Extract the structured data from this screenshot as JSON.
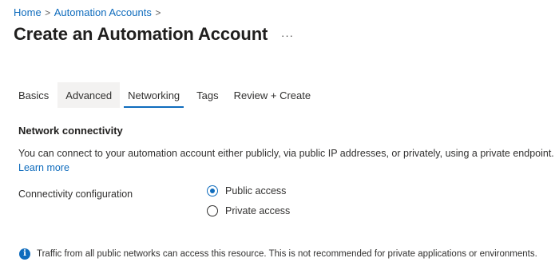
{
  "breadcrumb": {
    "items": [
      "Home",
      "Automation Accounts"
    ],
    "separator": ">"
  },
  "header": {
    "title": "Create an Automation Account",
    "more_label": "···"
  },
  "tabs": [
    {
      "label": "Basics"
    },
    {
      "label": "Advanced"
    },
    {
      "label": "Networking"
    },
    {
      "label": "Tags"
    },
    {
      "label": "Review + Create"
    }
  ],
  "active_tab": "Networking",
  "hovered_tab": "Advanced",
  "network": {
    "section_title": "Network connectivity",
    "description": "You can connect to your automation account either publicly, via public IP addresses, or privately, using a private endpoint.",
    "learn_more": "Learn more",
    "connectivity_label": "Connectivity configuration",
    "options": [
      {
        "label": "Public access",
        "selected": true
      },
      {
        "label": "Private access",
        "selected": false
      }
    ]
  },
  "info": {
    "icon": "info-icon",
    "text": "Traffic from all public networks can access this resource. This is not recommended for private applications or environments."
  },
  "colors": {
    "accent": "#0f6cbd",
    "text": "#323130",
    "tab_hover_bg": "#f3f2f1"
  }
}
